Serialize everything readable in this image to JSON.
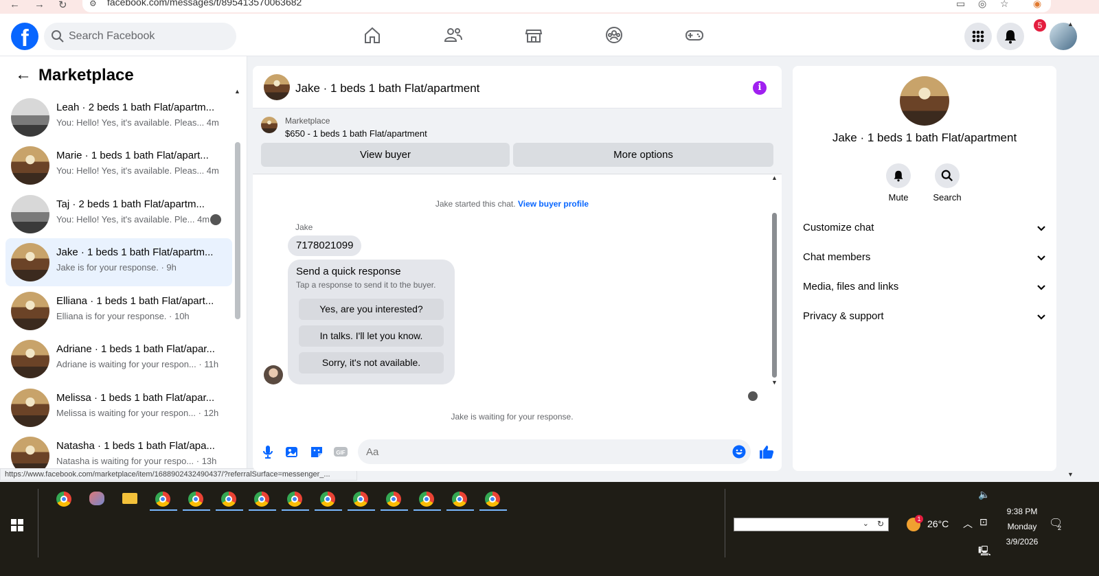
{
  "browser": {
    "url": "facebook.com/messages/t/895413570063682"
  },
  "topnav": {
    "search_placeholder": "Search Facebook",
    "notification_count": "5"
  },
  "sidebar": {
    "title": "Marketplace",
    "conversations": [
      {
        "name": "Leah · 2 beds 1 bath Flat/apartm...",
        "preview": "You: Hello! Yes, it's available. Pleas...  4m",
        "thumb": "gray"
      },
      {
        "name": "Marie · 1 beds 1 bath Flat/apart...",
        "preview": "You: Hello! Yes, it's available. Pleas...  4m",
        "thumb": "kitchen"
      },
      {
        "name": "Taj · 2 beds 1 bath Flat/apartm...",
        "preview": "You: Hello! Yes, it's available. Ple...  4m",
        "thumb": "gray"
      },
      {
        "name": "Jake · 1 beds 1 bath Flat/apartm...",
        "preview": "Jake is for your response. · 9h",
        "thumb": "kitchen"
      },
      {
        "name": "Elliana · 1 beds 1 bath Flat/apart...",
        "preview": "Elliana is for your response. · 10h",
        "thumb": "kitchen"
      },
      {
        "name": "Adriane · 1 beds 1 bath Flat/apar...",
        "preview": "Adriane is waiting for your respon... · 11h",
        "thumb": "kitchen"
      },
      {
        "name": "Melissa · 1 beds 1 bath Flat/apar...",
        "preview": "Melissa is waiting for your respon... · 12h",
        "thumb": "kitchen"
      },
      {
        "name": "Natasha · 1 beds 1 bath Flat/apa...",
        "preview": "Natasha is waiting for your respo... · 13h",
        "thumb": "kitchen"
      }
    ],
    "status_url": "https://www.facebook.com/marketplace/item/1688902432490437/?referralSurface=messenger_..."
  },
  "chat": {
    "title": "Jake · 1 beds 1 bath Flat/apartment",
    "marketplace_label": "Marketplace",
    "listing": "$650 - 1 beds 1 bath Flat/apartment",
    "view_buyer": "View buyer",
    "more_options": "More options",
    "started_text": "Jake started this chat.",
    "view_profile": "View buyer profile",
    "sender": "Jake",
    "message": "7178021099",
    "quick_title": "Send a quick response",
    "quick_sub": "Tap a response to send it to the buyer.",
    "quick_replies": [
      "Yes, are you interested?",
      "In talks. I'll let you know.",
      "Sorry, it's not available."
    ],
    "waiting": "Jake is waiting for your response.",
    "composer_placeholder": "Aa"
  },
  "details": {
    "title": "Jake · 1 beds 1 bath Flat/apartment",
    "mute": "Mute",
    "search": "Search",
    "sections": [
      "Customize chat",
      "Chat members",
      "Media, files and links",
      "Privacy & support"
    ]
  },
  "taskbar": {
    "temperature": "26°C",
    "time": "9:38 PM",
    "day": "Monday",
    "date": "3/9/2026",
    "weather_badge": "1",
    "action_center_count": "2"
  },
  "colors": {
    "fb_blue": "#0866ff",
    "active_row": "#e9f2fe",
    "info_purple": "#a020f0",
    "badge_red": "#e41e3f"
  }
}
